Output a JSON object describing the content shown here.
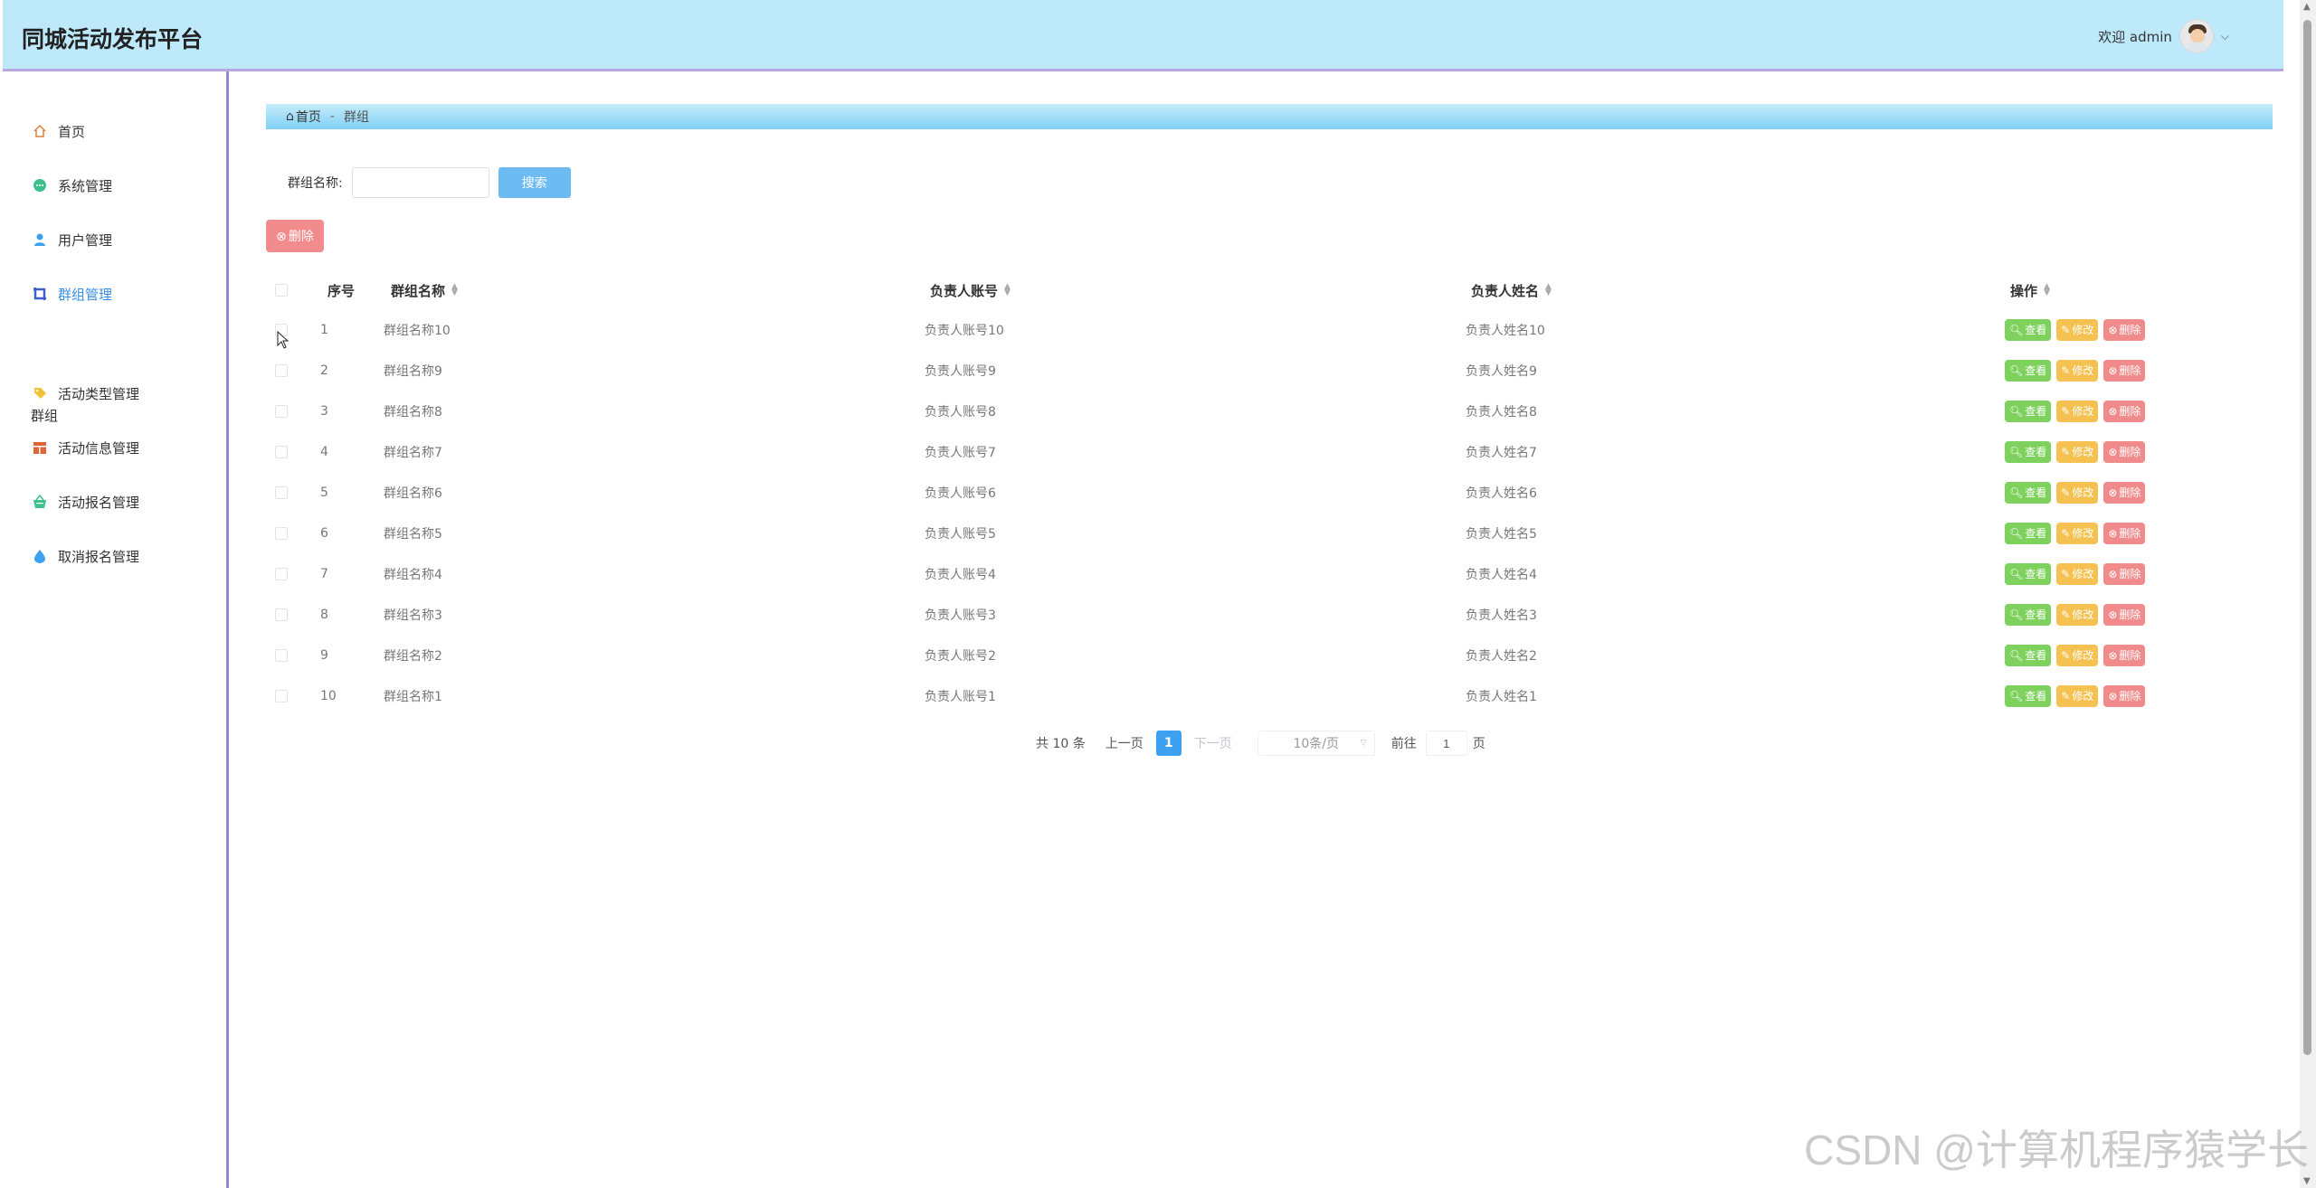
{
  "header": {
    "title": "同城活动发布平台",
    "welcome": "欢迎 admin"
  },
  "sidebar": {
    "items": [
      {
        "label": "首页",
        "icon": "home-icon"
      },
      {
        "label": "系统管理",
        "icon": "settings-icon"
      },
      {
        "label": "用户管理",
        "icon": "user-icon"
      },
      {
        "label": "群组管理",
        "icon": "group-icon",
        "active": true
      },
      {
        "label": "活动类型管理",
        "icon": "tag-icon"
      },
      {
        "label": "活动信息管理",
        "icon": "calendar-icon"
      },
      {
        "label": "活动报名管理",
        "icon": "basket-icon"
      },
      {
        "label": "取消报名管理",
        "icon": "drop-icon"
      }
    ],
    "group_label": "群组"
  },
  "breadcrumb": {
    "home": "首页",
    "separator": "-",
    "current": "群组"
  },
  "search": {
    "label": "群组名称:",
    "value": "",
    "placeholder": "",
    "button": "搜索"
  },
  "bulk_delete": "删除",
  "table": {
    "headers": {
      "index": "序号",
      "name": "群组名称",
      "account": "负责人账号",
      "person": "负责人姓名",
      "ops": "操作"
    },
    "rows": [
      {
        "index": "1",
        "name": "群组名称10",
        "account": "负责人账号10",
        "person": "负责人姓名10"
      },
      {
        "index": "2",
        "name": "群组名称9",
        "account": "负责人账号9",
        "person": "负责人姓名9"
      },
      {
        "index": "3",
        "name": "群组名称8",
        "account": "负责人账号8",
        "person": "负责人姓名8"
      },
      {
        "index": "4",
        "name": "群组名称7",
        "account": "负责人账号7",
        "person": "负责人姓名7"
      },
      {
        "index": "5",
        "name": "群组名称6",
        "account": "负责人账号6",
        "person": "负责人姓名6"
      },
      {
        "index": "6",
        "name": "群组名称5",
        "account": "负责人账号5",
        "person": "负责人姓名5"
      },
      {
        "index": "7",
        "name": "群组名称4",
        "account": "负责人账号4",
        "person": "负责人姓名4"
      },
      {
        "index": "8",
        "name": "群组名称3",
        "account": "负责人账号3",
        "person": "负责人姓名3"
      },
      {
        "index": "9",
        "name": "群组名称2",
        "account": "负责人账号2",
        "person": "负责人姓名2"
      },
      {
        "index": "10",
        "name": "群组名称1",
        "account": "负责人账号1",
        "person": "负责人姓名1"
      }
    ],
    "actions": {
      "view": "查看",
      "edit": "修改",
      "delete": "删除"
    }
  },
  "pagination": {
    "total": "共 10 条",
    "prev": "上一页",
    "current_page": "1",
    "next": "下一页",
    "page_size": "10条/页",
    "goto_label": "前往",
    "goto_value": "1",
    "page_suffix": "页"
  },
  "watermark": "CSDN @计算机程序猿学长",
  "colors": {
    "header_bg": "#bde9fb",
    "accent": "#3da1f2",
    "view": "#7dd15c",
    "edit": "#f5c150",
    "delete": "#f18b8b"
  }
}
